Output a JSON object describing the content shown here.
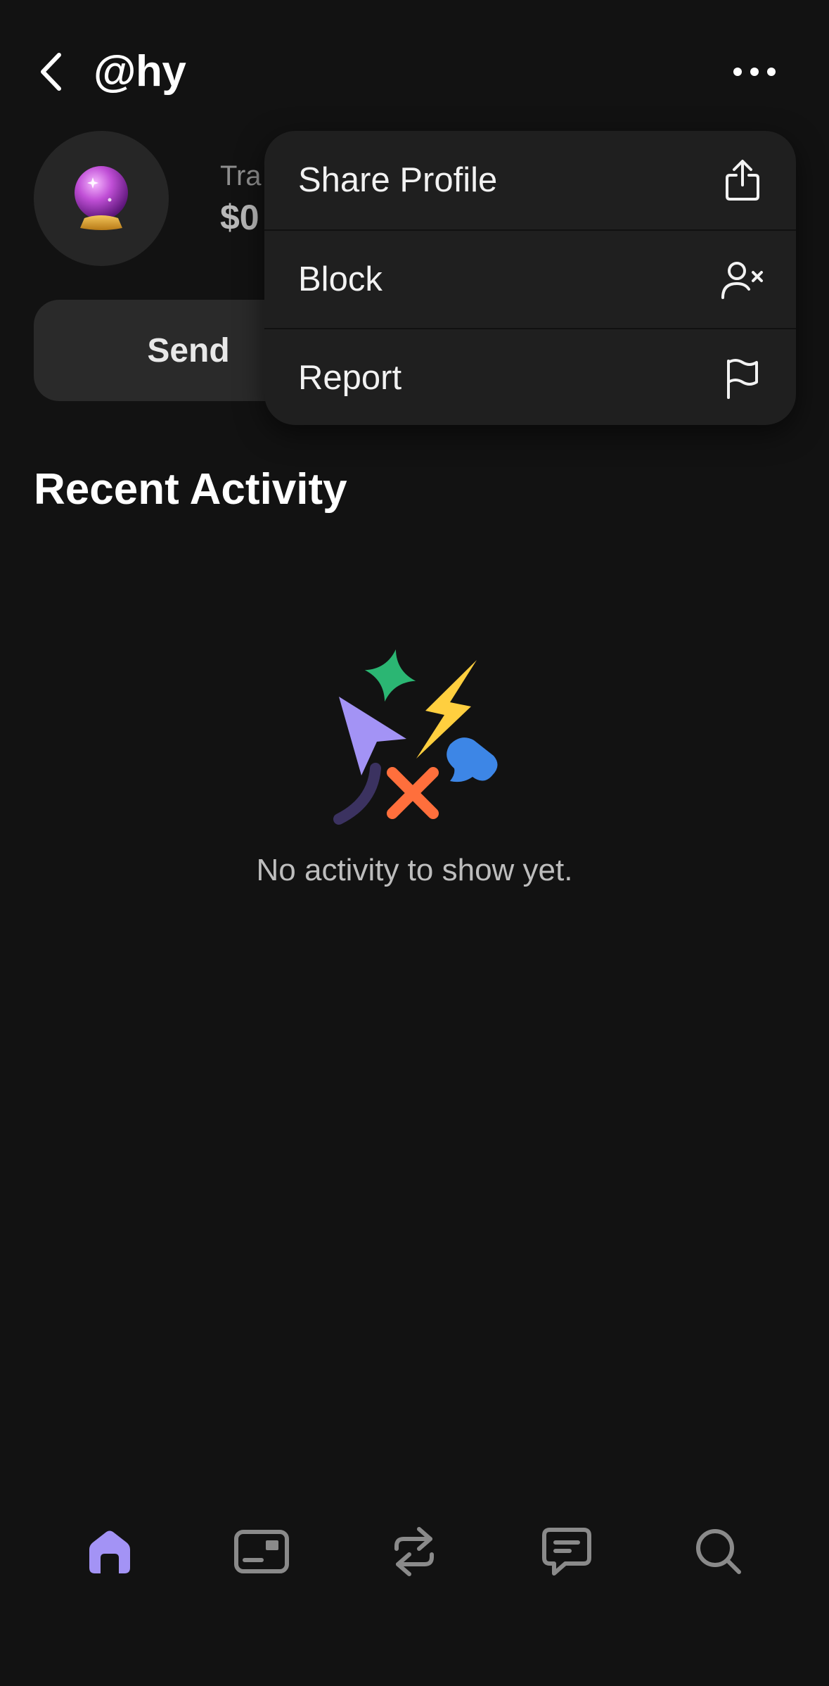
{
  "header": {
    "username": "@hy"
  },
  "profile": {
    "avatar_emoji": "🔮",
    "stat_label": "Tra",
    "stat_value": "$0"
  },
  "actions": {
    "send_label": "Send"
  },
  "menu": {
    "items": [
      {
        "label": "Share Profile",
        "icon": "share-icon"
      },
      {
        "label": "Block",
        "icon": "block-user-icon"
      },
      {
        "label": "Report",
        "icon": "flag-icon"
      }
    ]
  },
  "activity": {
    "title": "Recent Activity",
    "empty_text": "No activity to show yet."
  },
  "tabbar": {
    "items": [
      {
        "icon": "home-icon",
        "active": true
      },
      {
        "icon": "card-icon",
        "active": false
      },
      {
        "icon": "transfer-icon",
        "active": false
      },
      {
        "icon": "chat-icon",
        "active": false
      },
      {
        "icon": "search-icon",
        "active": false
      }
    ]
  },
  "colors": {
    "background": "#121212",
    "accent": "#A393F5",
    "menu_bg": "#1F1F1F",
    "inactive_icon": "#8A8A8A"
  }
}
